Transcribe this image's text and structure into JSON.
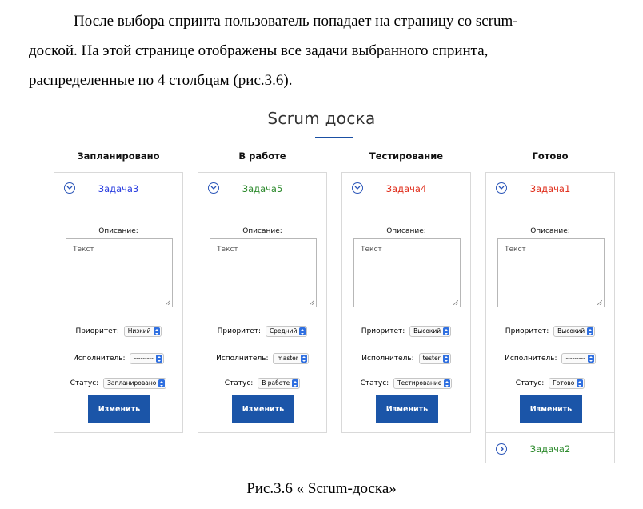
{
  "paragraph": {
    "line1": "После выбора спринта пользователь попадает на страницу со scrum-",
    "line2": "доской. На этой странице отображены все задачи выбранного спринта,",
    "line3": "распределенные по 4 столбцам (рис.3.6)."
  },
  "board": {
    "title": "Scrum доска",
    "accent_color": "#1b55a8",
    "description_label": "Описание:",
    "priority_label": "Приоритет:",
    "assignee_label": "Исполнитель:",
    "status_label": "Статус:",
    "button_label": "Изменить",
    "columns": [
      {
        "header": "Запланировано",
        "task": {
          "name": "Задача3",
          "color": "#2b3fe0",
          "description": "Текст",
          "priority": "Низкий",
          "assignee": "---------",
          "status": "Запланировано"
        }
      },
      {
        "header": "В работе",
        "task": {
          "name": "Задача5",
          "color": "#2e8b2e",
          "description": "Текст",
          "priority": "Средний",
          "assignee": "master",
          "status": "В работе"
        }
      },
      {
        "header": "Тестирование",
        "task": {
          "name": "Задача4",
          "color": "#e0301e",
          "description": "Текст",
          "priority": "Высокий",
          "assignee": "tester",
          "status": "Тестирование"
        }
      },
      {
        "header": "Готово",
        "task": {
          "name": "Задача1",
          "color": "#e0301e",
          "description": "Текст",
          "priority": "Высокий",
          "assignee": "---------",
          "status": "Готово"
        },
        "collapsed_task": {
          "name": "Задача2",
          "color": "#2e8b2e"
        }
      }
    ]
  },
  "caption": "Рис.3.6 « Scrum-доска»"
}
